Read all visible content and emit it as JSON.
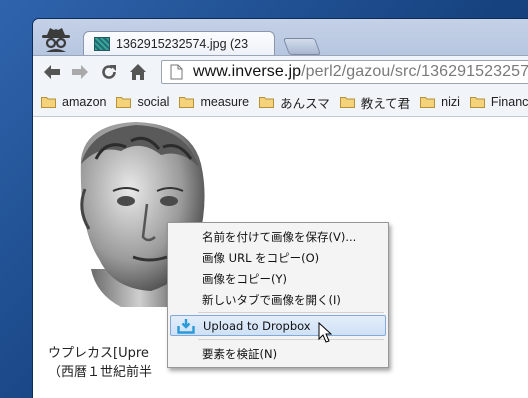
{
  "browser": {
    "tab": {
      "title": "1362915232574.jpg (23",
      "favicon": "image-favicon-icon"
    },
    "nav": {
      "back": "back-arrow-icon",
      "forward": "forward-arrow-icon",
      "reload": "reload-icon",
      "home": "home-icon"
    },
    "omnibox": {
      "domain": "www.inverse.jp",
      "path": "/perl2/gazou/src/136291523257"
    },
    "bookmarks": [
      {
        "label": "amazon"
      },
      {
        "label": "social"
      },
      {
        "label": "measure"
      },
      {
        "label": "あんスマ"
      },
      {
        "label": "教えて君"
      },
      {
        "label": "nizi"
      },
      {
        "label": "Financ"
      }
    ]
  },
  "page": {
    "caption_line1": "ウプレカス[Upre",
    "caption_line2": "（西暦１世紀前半"
  },
  "context_menu": {
    "items": [
      {
        "label": "名前を付けて画像を保存(V)..."
      },
      {
        "label": "画像 URL をコピー(O)"
      },
      {
        "label": "画像をコピー(Y)"
      },
      {
        "label": "新しいタブで画像を開く(I)"
      },
      {
        "label": "Upload to Dropbox",
        "icon": "dropbox-upload-icon",
        "highlighted": true
      },
      {
        "label": "要素を検証(N)"
      }
    ]
  },
  "colors": {
    "highlight": "#cfe1f6",
    "highlight_border": "#83a9d9",
    "dropbox_icon": "#2a9bd8"
  }
}
